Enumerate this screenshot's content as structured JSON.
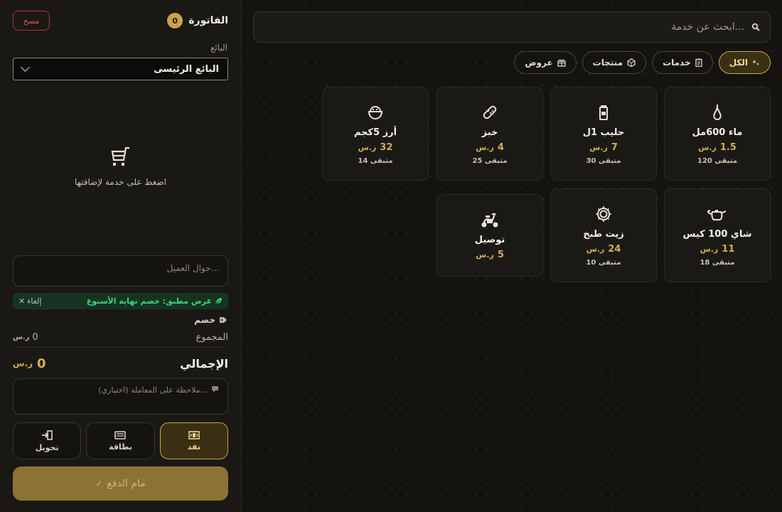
{
  "invoice": {
    "title": "الفاتورة",
    "count": "0",
    "clear_label": "مسح",
    "seller_label": "البائع",
    "seller_value": "البائع الرئيسى",
    "empty_text": "اضغط على خدمة لإضافتها",
    "phone_placeholder": "جوال العميل...",
    "promo_text": "عرض مطبق: خصم نهاية الأسبوع",
    "promo_cancel": "إلغاء",
    "discount_label": "خصم",
    "subtotal_label": "المجموع",
    "subtotal_value": "0",
    "grand_label": "الإجمالي",
    "grand_value": "0",
    "note_placeholder": "ملاحظة على المعاملة (اختياري)...",
    "currency_symbol": "ر.س",
    "payment_methods": [
      {
        "label": "نقد",
        "icon": "cash-icon",
        "active": true
      },
      {
        "label": "بطاقة",
        "icon": "card-icon",
        "active": false
      },
      {
        "label": "تحويل",
        "icon": "transfer-icon",
        "active": false
      }
    ],
    "submit_label": "مام الدفع"
  },
  "search": {
    "placeholder": "ابحث عن خدمة..."
  },
  "categories": [
    {
      "label": "الكل",
      "icon": "sparkle-icon",
      "active": true
    },
    {
      "label": "خدمات",
      "icon": "clipboard-icon",
      "active": false
    },
    {
      "label": "منتجات",
      "icon": "box-icon",
      "active": false
    },
    {
      "label": "عروض",
      "icon": "gift-icon",
      "active": false
    }
  ],
  "products": [
    {
      "name": "ماء 600مل",
      "price": "1.5",
      "stock": "متبقى 120",
      "icon": "water-drop-icon"
    },
    {
      "name": "حليب 1ل",
      "price": "7",
      "stock": "متبقى 30",
      "icon": "milk-icon"
    },
    {
      "name": "خبز",
      "price": "4",
      "stock": "متبقى 25",
      "icon": "bread-icon"
    },
    {
      "name": "أرز 5كجم",
      "price": "32",
      "stock": "متبقى 14",
      "icon": "rice-bowl-icon"
    },
    {
      "name": "شاي 100 كيس",
      "price": "11",
      "stock": "متبقى 18",
      "icon": "teapot-icon"
    },
    {
      "name": "زيت طبخ",
      "price": "24",
      "stock": "متبقى 10",
      "icon": "oil-icon"
    },
    {
      "name": "توصيل",
      "price": "5",
      "stock": "",
      "icon": "scooter-icon"
    }
  ]
}
